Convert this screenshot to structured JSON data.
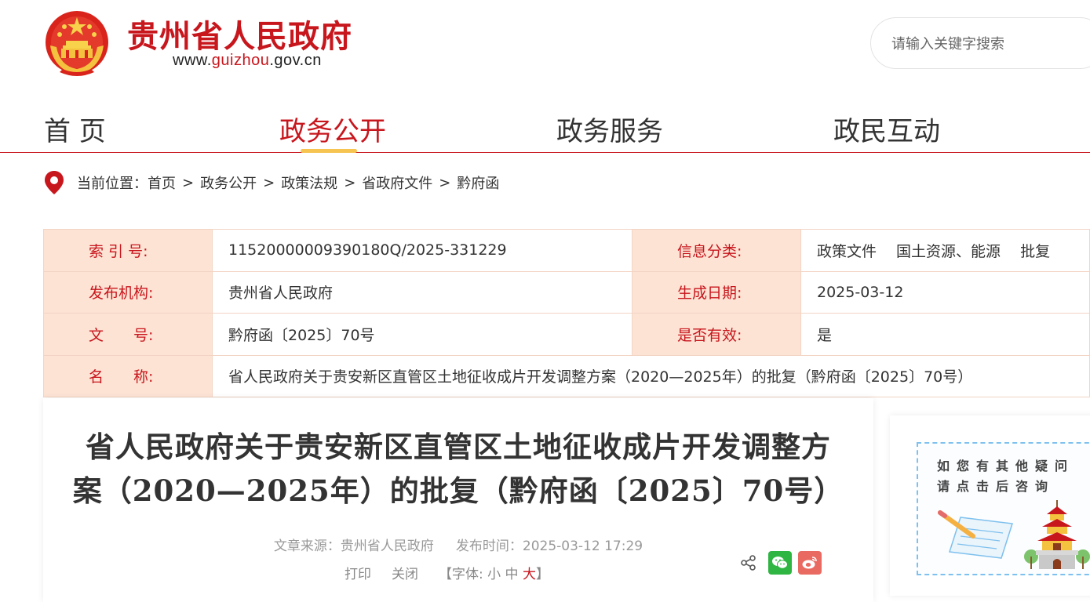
{
  "header": {
    "site_title": "贵州省人民政府",
    "site_url": {
      "prefix": "www.",
      "middle": "guizhou",
      "suffix": ".gov.cn"
    },
    "search_placeholder": "请输入关键字搜索"
  },
  "nav": {
    "items": [
      {
        "label": "首 页",
        "active": false
      },
      {
        "label": "政务公开",
        "active": true
      },
      {
        "label": "政务服务",
        "active": false
      },
      {
        "label": "政民互动",
        "active": false
      }
    ]
  },
  "breadcrumb": {
    "prefix": "当前位置：",
    "items": [
      "首页",
      "政务公开",
      "政策法规",
      "省政府文件",
      "黔府函"
    ],
    "separator": ">"
  },
  "info": {
    "index_label": "索 引 号:",
    "index_value": "11520000009390180Q/2025-331229",
    "category_label": "信息分类:",
    "category_value": "政策文件　 国土资源、能源　 批复",
    "publisher_label": "发布机构:",
    "publisher_value": "贵州省人民政府",
    "date_label": "生成日期:",
    "date_value": "2025-03-12",
    "docno_label": "文　　号:",
    "docno_value": "黔府函〔2025〕70号",
    "valid_label": "是否有效:",
    "valid_value": "是",
    "name_label": "名　　称:",
    "name_value": "省人民政府关于贵安新区直管区土地征收成片开发调整方案（2020—2025年）的批复（黔府函〔2025〕70号）"
  },
  "article": {
    "title_line1": "省人民政府关于贵安新区直管区土地征收成片开发调整方",
    "title_line2": "案（2020—2025年）的批复（黔府函〔2025〕70号）",
    "source": "文章来源：贵州省人民政府",
    "publish_time": "发布时间：2025-03-12 17:29",
    "print_label": "打印",
    "close_label": "关闭",
    "font_prefix": "【字体:",
    "font_small": "小",
    "font_medium": "中",
    "font_large": "大",
    "font_suffix": "】"
  },
  "consult": {
    "line1": "如您有其他疑问",
    "line2": "请点击后咨询"
  },
  "colors": {
    "brand_red": "#c8161d",
    "label_bg": "#fde3d4",
    "nav_underline": "#f5c451"
  }
}
